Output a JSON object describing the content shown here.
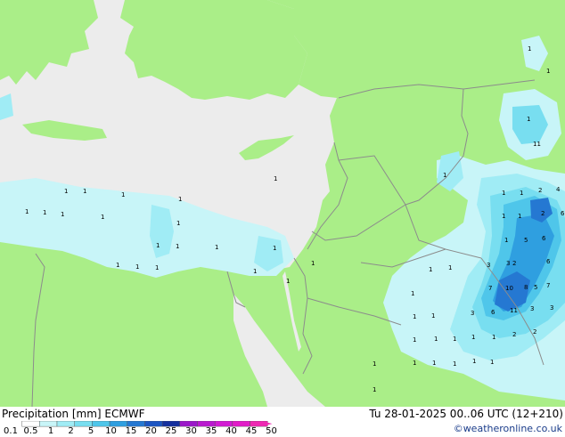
{
  "title": {
    "variable": "Precipitation [mm]",
    "model": "ECMWF"
  },
  "valid_time": "Tu 28-01-2025 00..06 UTC (12+210)",
  "credit": "©weatheronline.co.uk",
  "legend": {
    "labels": [
      "0.1",
      "0.5",
      "1",
      "2",
      "5",
      "10",
      "15",
      "20",
      "25",
      "30",
      "35",
      "40",
      "45",
      "50"
    ],
    "colors": [
      "#ffffff",
      "#c8f5f8",
      "#a0ecf5",
      "#78def0",
      "#4fc6ea",
      "#2f9fe0",
      "#2578d2",
      "#1c55c2",
      "#15309e",
      "#9b17c9",
      "#b919cf",
      "#d21ad3",
      "#e21cc8",
      "#ee28b2"
    ]
  },
  "map_labels": [
    "1",
    "1",
    "1",
    "1",
    "1",
    "1",
    "1",
    "1",
    "1",
    "1",
    "1",
    "1",
    "1",
    "1",
    "1",
    "1",
    "1",
    "1",
    "1",
    "1",
    "1",
    "1",
    "1",
    "1",
    "1",
    "1",
    "1",
    "1",
    "1",
    "1",
    "1",
    "1",
    "1",
    "1",
    "1",
    "1",
    "1",
    "1",
    "1",
    "1",
    "1",
    "1",
    "1",
    "1",
    "1",
    "1",
    "2",
    "2",
    "2",
    "2",
    "2",
    "3",
    "3",
    "3",
    "3",
    "3",
    "4",
    "5",
    "5",
    "6",
    "6",
    "6",
    "7",
    "7",
    "8",
    "10",
    "11",
    "11",
    "6",
    "3"
  ],
  "colors": {
    "land": "#aaee88",
    "sea": "#ececec",
    "border": "#8c8c8c"
  }
}
